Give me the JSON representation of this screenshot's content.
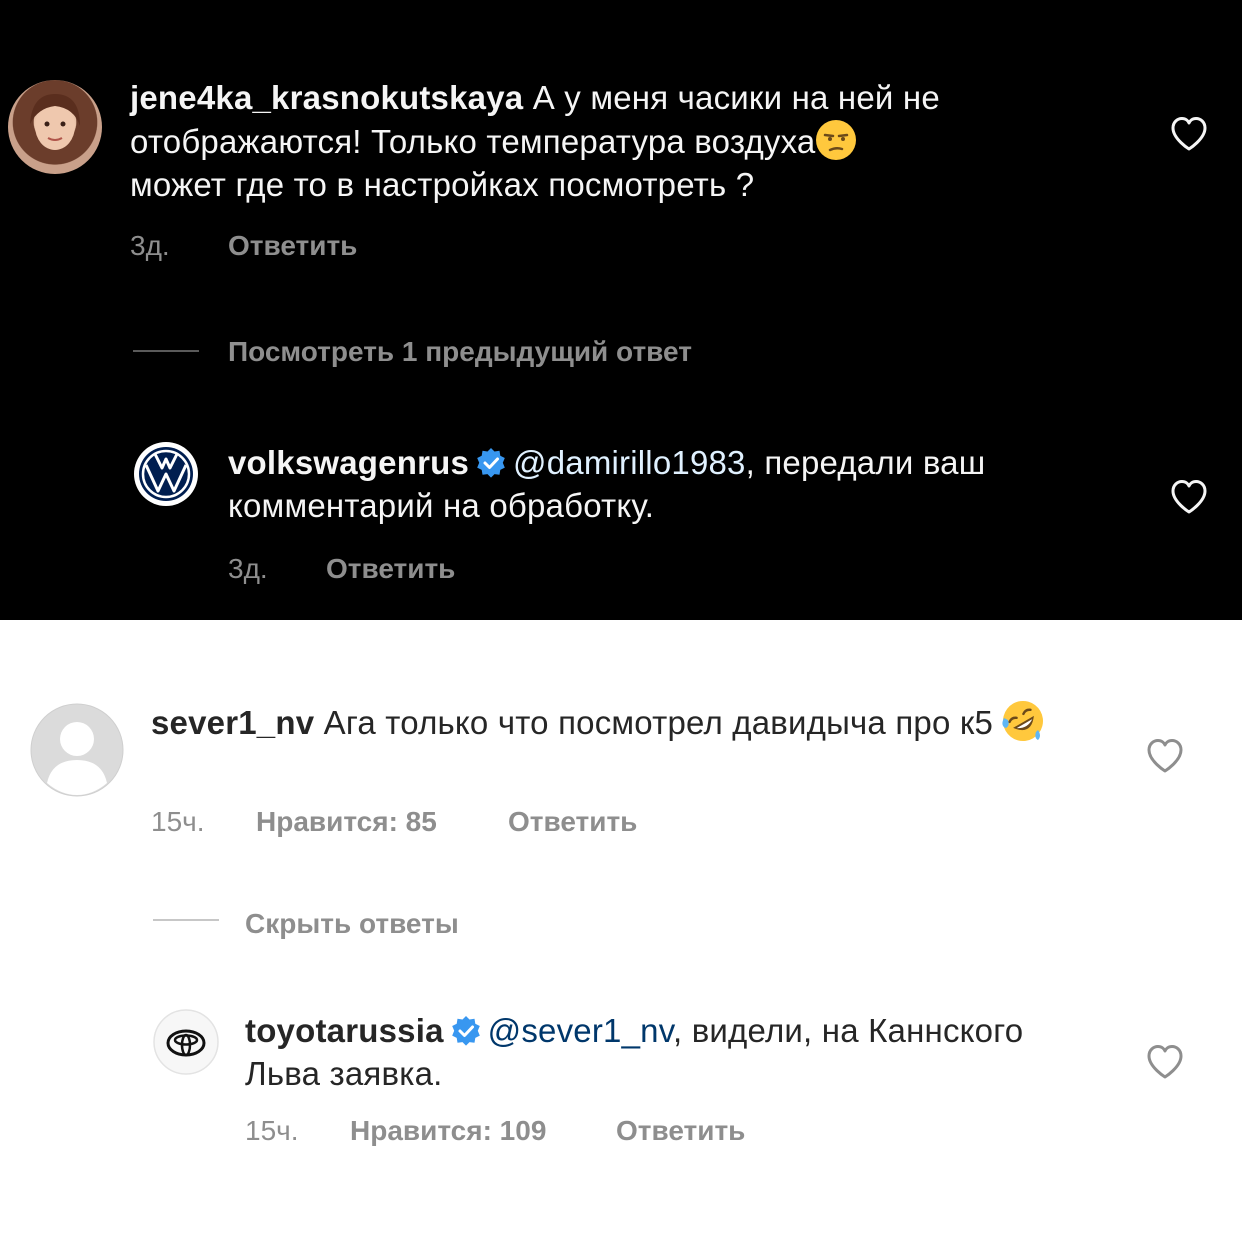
{
  "top_thread": {
    "comment": {
      "username": "jene4ka_krasnokutskaya",
      "text": " А у меня часики на ней не отображаются! Только температура воздуха",
      "text_tail": "может где то в настройках посмотреть ?",
      "emoji": "unamused-face-emoji",
      "time": "3д.",
      "reply_label": "Ответить"
    },
    "view_previous_replies": "Посмотреть 1 предыдущий ответ",
    "reply": {
      "username": "volkswagenrus",
      "mention": "@damirillo1983",
      "text": ", передали ваш комментарий на обработку.",
      "time": "3д.",
      "reply_label": "Ответить"
    }
  },
  "bottom_thread": {
    "comment": {
      "username": "sever1_nv",
      "text": " Ага только что посмотрел давидыча про к5 ",
      "emoji": "rolling-on-floor-laughing-emoji",
      "time": "15ч.",
      "likes_label": "Нравится: 85",
      "reply_label": "Ответить"
    },
    "hide_replies": "Скрыть ответы",
    "reply": {
      "username": "toyotarussia",
      "mention": "@sever1_nv",
      "text": ", видели, на Каннского Льва заявка.",
      "time": "15ч.",
      "likes_label": "Нравится: 109",
      "reply_label": "Ответить"
    }
  },
  "colors": {
    "verified_blue": "#3897f0",
    "dark_bg": "#000000",
    "light_bg": "#ffffff",
    "muted": "#8e8e8e"
  }
}
